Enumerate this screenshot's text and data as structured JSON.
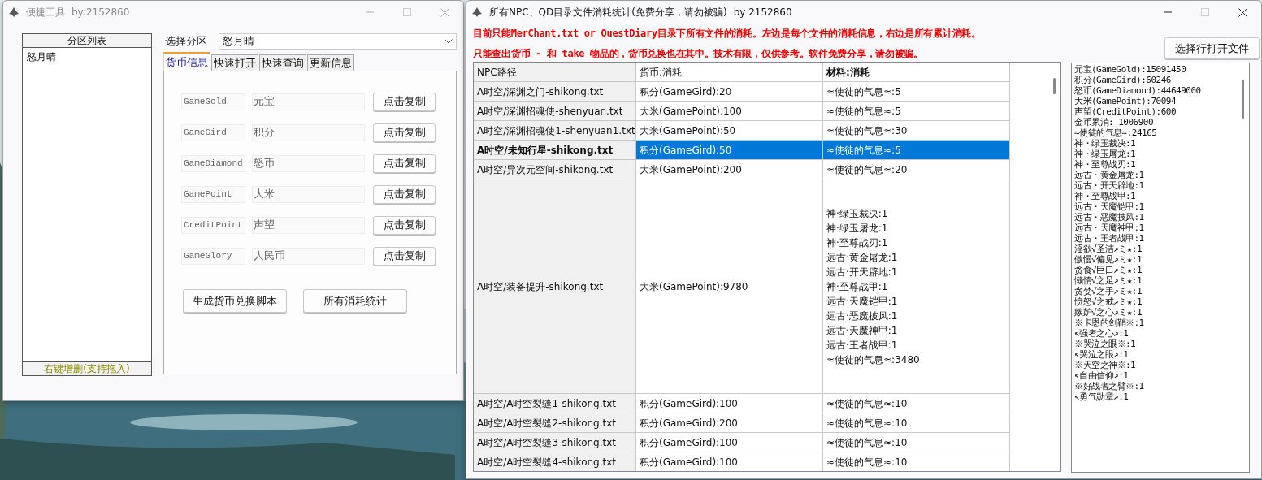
{
  "left_window": {
    "title": "便捷工具",
    "author": "by:2152860",
    "partition_list": {
      "header": "分区列表",
      "items": [
        {
          "label": "怒月晴",
          "selected": false
        }
      ],
      "footer": "右键增删(支持拖入)"
    },
    "select_label": "选择分区",
    "select_value": "怒月晴",
    "tabs": [
      {
        "label": "货币信息",
        "selected": true
      },
      {
        "label": "快速打开",
        "selected": false
      },
      {
        "label": "快速查询",
        "selected": false
      },
      {
        "label": "更新信息",
        "selected": false
      }
    ],
    "currency_rows": [
      {
        "code": "GameGold",
        "name": "元宝",
        "button": "点击复制"
      },
      {
        "code": "GameGird",
        "name": "积分",
        "button": "点击复制"
      },
      {
        "code": "GameDiamond",
        "name": "怒币",
        "button": "点击复制"
      },
      {
        "code": "GamePoint",
        "name": "大米",
        "button": "点击复制"
      },
      {
        "code": "CreditPoint",
        "name": "声望",
        "button": "点击复制"
      },
      {
        "code": "GameGlory",
        "name": "人民币",
        "button": "点击复制"
      }
    ],
    "buttons": [
      "生成货币兑换脚本",
      "所有消耗统计"
    ]
  },
  "right_window": {
    "title": "所有NPC、QD目录文件消耗统计(免费分享，请勿被骗)",
    "author": "by 2152860",
    "notices": [
      "目前只能MerChant.txt or QuestDiary目录下所有文件的消耗。左边是每个文件的消耗信息，右边是所有累计消耗。",
      "只能查出货币 - 和 take 物品的，货币兑换也在其中。技术有限，仅供参考。软件免费分享，请勿被骗。"
    ],
    "open_button": "选择行打开文件",
    "table": {
      "columns": [
        {
          "label": "NPC路径",
          "bold": false
        },
        {
          "label": "货币:消耗",
          "bold": false
        },
        {
          "label": "材料:消耗",
          "bold": true
        }
      ],
      "rows": [
        {
          "path": "A时空/深渊之门-shikong.txt",
          "currency": "积分(GameGird):20",
          "materials": [
            "≈使徒的气息≈:5"
          ],
          "selected": false
        },
        {
          "path": "A时空/深渊招魂使-shenyuan.txt",
          "currency": "大米(GamePoint):100",
          "materials": [
            "≈使徒的气息≈:5"
          ],
          "selected": false
        },
        {
          "path": "A时空/深渊招魂使1-shenyuan1.txt",
          "currency": "大米(GamePoint):50",
          "materials": [
            "≈使徒的气息≈:30"
          ],
          "selected": false
        },
        {
          "path": "A时空/未知行星-shikong.txt",
          "currency": "积分(GameGird):50",
          "materials": [
            "≈使徒的气息≈:5"
          ],
          "selected": true
        },
        {
          "path": "A时空/异次元空间-shikong.txt",
          "currency": "大米(GamePoint):200",
          "materials": [
            "≈使徒的气息≈:20"
          ],
          "selected": false
        },
        {
          "path": "A时空/装备提升-shikong.txt",
          "currency": "大米(GamePoint):9780",
          "materials": [
            "神·绿玉裁决:1",
            "神·绿玉屠龙:1",
            "神·至尊战刃:1",
            "远古·黄金屠龙:1",
            "远古·开天辟地:1",
            "神·至尊战甲:1",
            "远古·天魔铠甲:1",
            "远古·恶魔披风:1",
            "远古·天魔神甲:1",
            "远古·王者战甲:1",
            "≈使徒的气息≈:3480"
          ],
          "selected": false
        },
        {
          "path": "A时空/A时空裂缝1-shikong.txt",
          "currency": "积分(GameGird):100",
          "materials": [
            "≈使徒的气息≈:10"
          ],
          "selected": false
        },
        {
          "path": "A时空/A时空裂缝2-shikong.txt",
          "currency": "积分(GameGird):200",
          "materials": [
            "≈使徒的气息≈:10"
          ],
          "selected": false
        },
        {
          "path": "A时空/A时空裂缝3-shikong.txt",
          "currency": "积分(GameGird):100",
          "materials": [
            "≈使徒的气息≈:10"
          ],
          "selected": false
        },
        {
          "path": "A时空/A时空裂缝4-shikong.txt",
          "currency": "积分(GameGird):100",
          "materials": [
            "≈使徒的气息≈:10"
          ],
          "selected": false
        }
      ]
    },
    "totals": [
      "元宝(GameGold):15091450",
      "积分(GameGird):60246",
      "怒币(GameDiamond):44649000",
      "大米(GamePoint):70094",
      "声望(CreditPoint):600",
      "金币累消: 1006900",
      "≈使徒的气息≈:24165",
      "神・绿玉裁决:1",
      "神・绿玉屠龙:1",
      "神・至尊战刃:1",
      "远古・黄金屠龙:1",
      "远古・开天辟地:1",
      "神・至尊战甲:1",
      "远古・天魔铠甲:1",
      "远古・恶魔披风:1",
      "远古・天魔神甲:1",
      "远古・王者战甲:1",
      "淫欲√圣洁↗ミ★:1",
      "傲慢√偏见↗ミ★:1",
      "贪食√巨口↗ミ★:1",
      "懒惰√之足↗ミ★:1",
      "贪婪√之手↗ミ★:1",
      "愤怒√之戒↗ミ★:1",
      "嫉妒√之心↗ミ★:1",
      "※卡恩的剑鞘※:1",
      "↖强者之心↗:1",
      "※哭泣之眼※:1",
      "↖哭泣之眼↗:1",
      "※天空之神※:1",
      "↖自由信仰↗:1",
      "※好战者之臂※:1",
      "↖勇气勋章↗:1"
    ]
  }
}
